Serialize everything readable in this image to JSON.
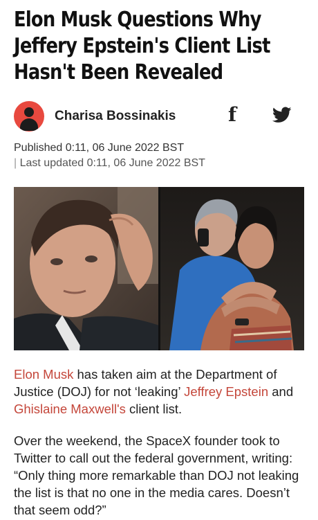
{
  "article": {
    "headline_lines": [
      "Elon Musk Questions Why",
      "Jeffery Epstein's Client List",
      "Hasn't Been Revealed"
    ],
    "author": "Charisa Bossinakis",
    "published": "Published 0:11, 06 June 2022 BST",
    "updated_prefix": "|",
    "updated": " Last updated 0:11, 06 June 2022 BST"
  },
  "share": {
    "facebook_icon": "facebook-icon",
    "twitter_icon": "twitter-icon",
    "facebook_glyph": "f"
  },
  "body": {
    "p1": {
      "link_musk": "Elon Musk",
      "text_a": " has taken aim at the Department of Justice (DOJ) for not ‘leaking’ ",
      "link_epstein": "Jeffrey Epstein",
      "text_b": " and ",
      "link_maxwell": "Ghislaine Maxwell's",
      "text_c": " client list."
    },
    "p2": "Over the weekend, the SpaceX founder took to Twitter to call out the federal government, writing: “Only thing more remarkable than DOJ not leaking the list is that no one in the media cares. Doesn’t that seem odd?”"
  },
  "colors": {
    "link": "#c4463a",
    "avatar": "#e8493f"
  }
}
